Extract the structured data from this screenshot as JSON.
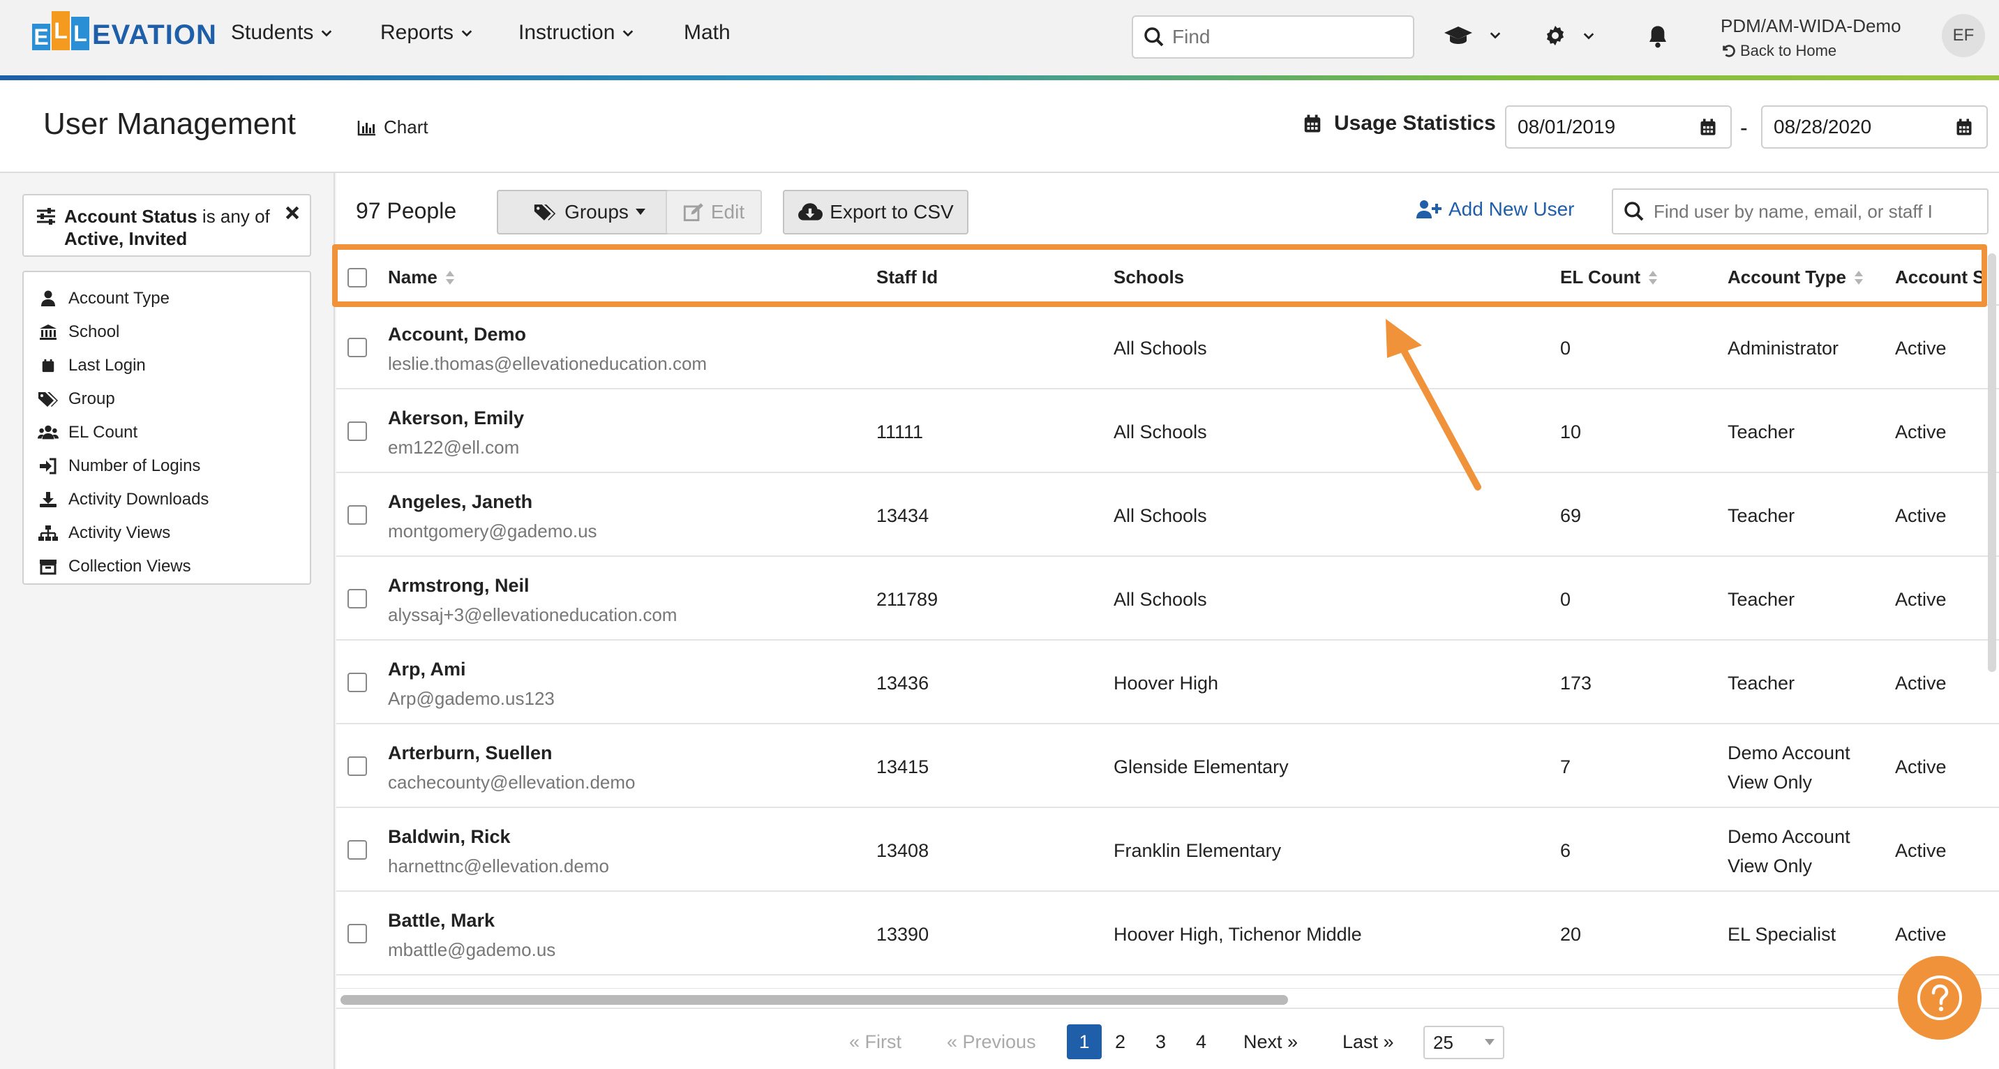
{
  "logo": {
    "e": "E",
    "l1": "L",
    "l2": "L",
    "rest": "EVATION"
  },
  "nav": {
    "students": "Students",
    "reports": "Reports",
    "instruction": "Instruction",
    "math": "Math",
    "find_placeholder": "Find",
    "org_name": "PDM/AM-WIDA-Demo",
    "back_home": "Back to Home",
    "avatar_initials": "EF"
  },
  "header": {
    "title": "User Management",
    "chart_label": "Chart",
    "usage_label": "Usage Statistics",
    "date_from": "08/01/2019",
    "date_sep": "-",
    "date_to": "08/28/2020"
  },
  "filters": {
    "active_filter": {
      "field": "Account Status",
      "op": "is any of",
      "values": "Active, Invited"
    },
    "items": [
      {
        "label": "Account Type",
        "icon": "user-icon"
      },
      {
        "label": "School",
        "icon": "building-icon"
      },
      {
        "label": "Last Login",
        "icon": "calendar-icon"
      },
      {
        "label": "Group",
        "icon": "tags-icon"
      },
      {
        "label": "EL Count",
        "icon": "users-icon"
      },
      {
        "label": "Number of Logins",
        "icon": "sign-in-icon"
      },
      {
        "label": "Activity Downloads",
        "icon": "download-icon"
      },
      {
        "label": "Activity Views",
        "icon": "sitemap-icon"
      },
      {
        "label": "Collection Views",
        "icon": "archive-icon"
      }
    ]
  },
  "toolbar": {
    "people_count": "97 People",
    "groups_label": "Groups",
    "edit_label": "Edit",
    "export_label": "Export to CSV",
    "add_user_label": "Add New User",
    "search_placeholder": "Find user by name, email, or staff I"
  },
  "table": {
    "columns": [
      "Name",
      "Staff Id",
      "Schools",
      "EL Count",
      "Account Type",
      "Account S"
    ],
    "rows": [
      {
        "name": "Account, Demo",
        "email": "leslie.thomas@ellevationeducation.com",
        "staff_id": "",
        "schools": "All Schools",
        "el_count": "0",
        "type1": "Administrator",
        "type2": "",
        "status": "Active"
      },
      {
        "name": "Akerson, Emily",
        "email": "em122@ell.com",
        "staff_id": "11111",
        "schools": "All Schools",
        "el_count": "10",
        "type1": "Teacher",
        "type2": "",
        "status": "Active"
      },
      {
        "name": "Angeles, Janeth",
        "email": "montgomery@gademo.us",
        "staff_id": "13434",
        "schools": "All Schools",
        "el_count": "69",
        "type1": "Teacher",
        "type2": "",
        "status": "Active"
      },
      {
        "name": "Armstrong, Neil",
        "email": "alyssaj+3@ellevationeducation.com",
        "staff_id": "211789",
        "schools": "All Schools",
        "el_count": "0",
        "type1": "Teacher",
        "type2": "",
        "status": "Active"
      },
      {
        "name": "Arp, Ami",
        "email": "Arp@gademo.us123",
        "staff_id": "13436",
        "schools": "Hoover High",
        "el_count": "173",
        "type1": "Teacher",
        "type2": "",
        "status": "Active"
      },
      {
        "name": "Arterburn, Suellen",
        "email": "cachecounty@ellevation.demo",
        "staff_id": "13415",
        "schools": "Glenside Elementary",
        "el_count": "7",
        "type1": "Demo Account",
        "type2": "View Only",
        "status": "Active"
      },
      {
        "name": "Baldwin, Rick",
        "email": "harnettnc@ellevation.demo",
        "staff_id": "13408",
        "schools": "Franklin Elementary",
        "el_count": "6",
        "type1": "Demo Account",
        "type2": "View Only",
        "status": "Active"
      },
      {
        "name": "Battle, Mark",
        "email": "mbattle@gademo.us",
        "staff_id": "13390",
        "schools": "Hoover High, Tichenor Middle",
        "el_count": "20",
        "type1": "EL Specialist",
        "type2": "",
        "status": "Active"
      }
    ]
  },
  "pager": {
    "first": "« First",
    "previous": "« Previous",
    "pages": [
      "1",
      "2",
      "3",
      "4"
    ],
    "next": "Next »",
    "last": "Last »",
    "per_page": "25"
  },
  "colors": {
    "accent_orange": "#f0923a",
    "brand_blue": "#1f5ea8",
    "logo_orange": "#f39a1f",
    "logo_blue": "#2a8fd4"
  }
}
